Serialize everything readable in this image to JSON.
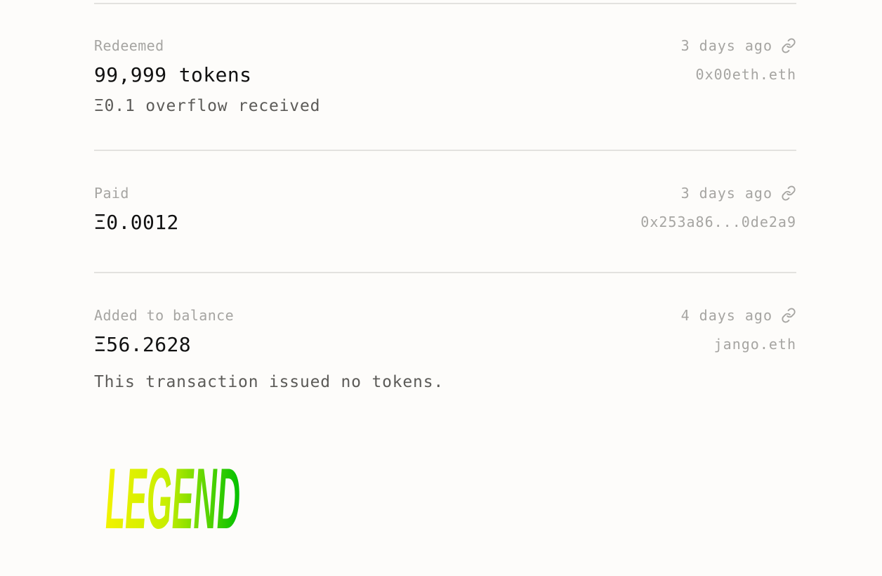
{
  "feed": {
    "entries": [
      {
        "kind": "Redeemed",
        "amount": "99,999 tokens",
        "note": "Ξ0.1 overflow received",
        "when": "3 days ago",
        "who": "0x00eth.eth",
        "link_icon": "link-icon"
      },
      {
        "kind": "Paid",
        "amount": "Ξ0.0012",
        "note": "",
        "when": "3 days ago",
        "who": "0x253a86...0de2a9",
        "link_icon": "link-icon"
      },
      {
        "kind": "Added to balance",
        "amount": "Ξ56.2628",
        "note": "This transaction issued no tokens.",
        "when": "4 days ago",
        "who": "jango.eth",
        "link_icon": "link-icon"
      }
    ]
  },
  "logo": {
    "text": "LEGEND",
    "gradient_start": "#f2f200",
    "gradient_end": "#00c000"
  },
  "colors": {
    "background": "#fdfcfa",
    "divider": "#e3e2df",
    "muted_text": "#a6a5a2",
    "primary_text": "#111111",
    "secondary_text": "#5c5b58"
  }
}
